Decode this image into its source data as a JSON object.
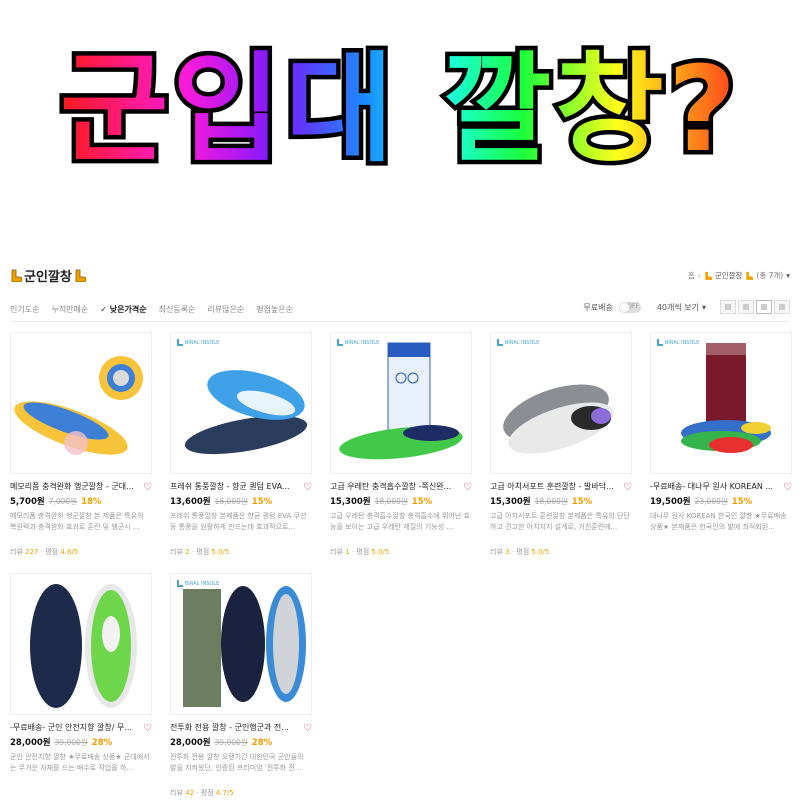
{
  "banner": {
    "headline": "군입대 깔창?"
  },
  "category": {
    "title": "군인깔창",
    "breadcrumb": {
      "home": "홈",
      "current": "군인깔창",
      "count": "(총 7개)"
    }
  },
  "sort": {
    "tabs": [
      "인기도순",
      "누적판매순",
      "낮은가격순",
      "최신등록순",
      "리뷰많은순",
      "평점높은순"
    ],
    "active": "낮은가격순",
    "free_shipping_label": "무료배송",
    "toggle_text": "OFF",
    "view_count": "40개씩 보기"
  },
  "brand_label": "BIRAL INSOLE",
  "products": [
    {
      "name": "메모리폼 충격완화 행군깔창 - 군대...",
      "price": "5,700원",
      "orig": "7,000원",
      "disc": "18%",
      "desc": "메모리폼 충격완화 행군깔창 본 제품은 특유의 복원력과 충격완화 효과로 훈련 및 행군시 ...",
      "review_label": "리뷰",
      "review_count": "227",
      "rating_label": "평점",
      "rating": "4.6/5"
    },
    {
      "name": "프레쉬 통풍깔창 - 향균 퀀텀 EVA...",
      "price": "13,600원",
      "orig": "16,000원",
      "disc": "15%",
      "desc": "프레쉬 통풍깔창 본제품은 향균 퀀텀 EVA 쿠션 등 통풍을 원활하게 만드는데 효과적으로...",
      "review_label": "리뷰",
      "review_count": "2",
      "rating_label": "평점",
      "rating": "5.0/5"
    },
    {
      "name": "고급 우레탄 충격흡수깔창 -쪽신완...",
      "price": "15,300원",
      "orig": "18,000원",
      "disc": "15%",
      "desc": "고급 우레탄 충격흡수깔창 충격흡수에 뛰어난 효능을 보이는 고급 우레탄 재질의 기능성 ...",
      "review_label": "리뷰",
      "review_count": "1",
      "rating_label": "평점",
      "rating": "5.0/5"
    },
    {
      "name": "고급 아치서포트 훈련깔창 - 발바닥...",
      "price": "15,300원",
      "orig": "18,000원",
      "disc": "15%",
      "desc": "고급 아치서포트 훈련깔창 본제품은 특유의 단단하고 견고한 아치지지 설계로, 거친훈련에...",
      "review_label": "리뷰",
      "review_count": "3",
      "rating_label": "평점",
      "rating": "5.0/5"
    },
    {
      "name": "-무료배송- 대나무 원사 KOREAN ...",
      "price": "19,500원",
      "orig": "23,000원",
      "disc": "15%",
      "desc": "대나무 원사 KOREAN 한국인 깔창 ★무료배송 상품★ 본제품은 한국인의 발에 최적화된...",
      "review_label": "",
      "review_count": "",
      "rating_label": "",
      "rating": ""
    },
    {
      "name": "-무료배송- 군인 안전지향 깔창/ 무...",
      "price": "28,000원",
      "orig": "39,000원",
      "disc": "28%",
      "desc": "군인 안전지향 깔창 ★무료배송 상품★ 군대에서는 무거운 자재를 드는 배수로 작업을 하...",
      "review_label": "",
      "review_count": "",
      "rating_label": "",
      "rating": ""
    },
    {
      "name": "전투화 전용 깔창 - 군인행군과 전...",
      "price": "28,000원",
      "orig": "39,000원",
      "disc": "28%",
      "desc": "전투화 전용 깔창 오랜기간 대한민국 군인들의 발을 지켜왔던, 인증된 프리미엄 '전투화 전...",
      "review_label": "리뷰",
      "review_count": "42",
      "rating_label": "평점",
      "rating": "4.7/5"
    }
  ],
  "colors": {
    "accent": "#f0a000",
    "heart": "#e0004d",
    "brand": "#4aa3c8"
  }
}
